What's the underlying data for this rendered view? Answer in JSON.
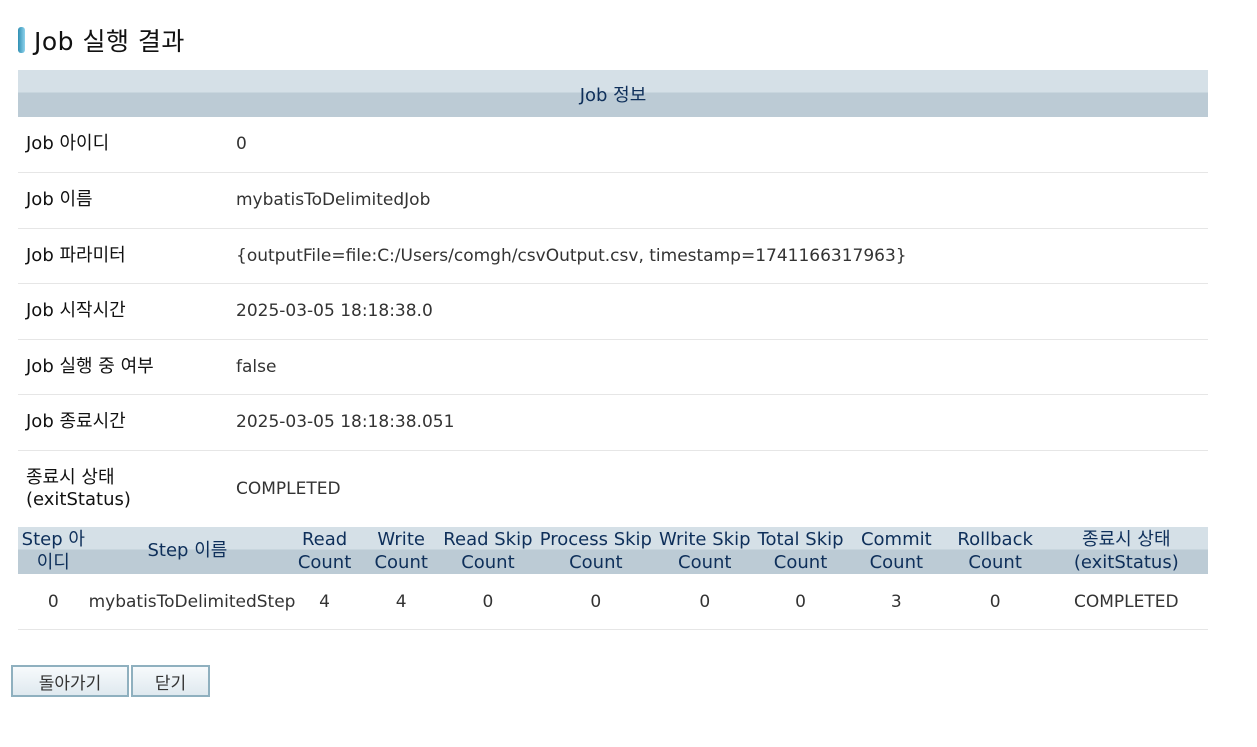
{
  "page": {
    "title": "Job 실행 결과"
  },
  "job_section": {
    "header": "Job 정보",
    "rows": [
      {
        "label": "Job 아이디",
        "value": "0"
      },
      {
        "label": "Job 이름",
        "value": "mybatisToDelimitedJob"
      },
      {
        "label": "Job 파라미터",
        "value": "{outputFile=file:C:/Users/comgh/csvOutput.csv, timestamp=1741166317963}"
      },
      {
        "label": "Job 시작시간",
        "value": "2025-03-05 18:18:38.0"
      },
      {
        "label": "Job 실행 중 여부",
        "value": "false"
      },
      {
        "label": "Job 종료시간",
        "value": "2025-03-05 18:18:38.051"
      },
      {
        "label": "종료시 상태",
        "label2": "(exitStatus)",
        "value": "COMPLETED"
      }
    ]
  },
  "step_section": {
    "columns": [
      {
        "l1": "Step 아",
        "l2": "이디"
      },
      {
        "l1": "Step 이름",
        "l2": ""
      },
      {
        "l1": "Read",
        "l2": "Count"
      },
      {
        "l1": "Write",
        "l2": "Count"
      },
      {
        "l1": "Read Skip",
        "l2": "Count"
      },
      {
        "l1": "Process Skip",
        "l2": "Count"
      },
      {
        "l1": "Write Skip",
        "l2": "Count"
      },
      {
        "l1": "Total Skip",
        "l2": "Count"
      },
      {
        "l1": "Commit",
        "l2": "Count"
      },
      {
        "l1": "Rollback",
        "l2": "Count"
      },
      {
        "l1": "종료시 상태",
        "l2": "(exitStatus)"
      }
    ],
    "rows": [
      [
        "0",
        "mybatisToDelimitedStep",
        "4",
        "4",
        "0",
        "0",
        "0",
        "0",
        "3",
        "0",
        "COMPLETED"
      ]
    ]
  },
  "buttons": {
    "back": "돌아가기",
    "close": "닫기"
  }
}
